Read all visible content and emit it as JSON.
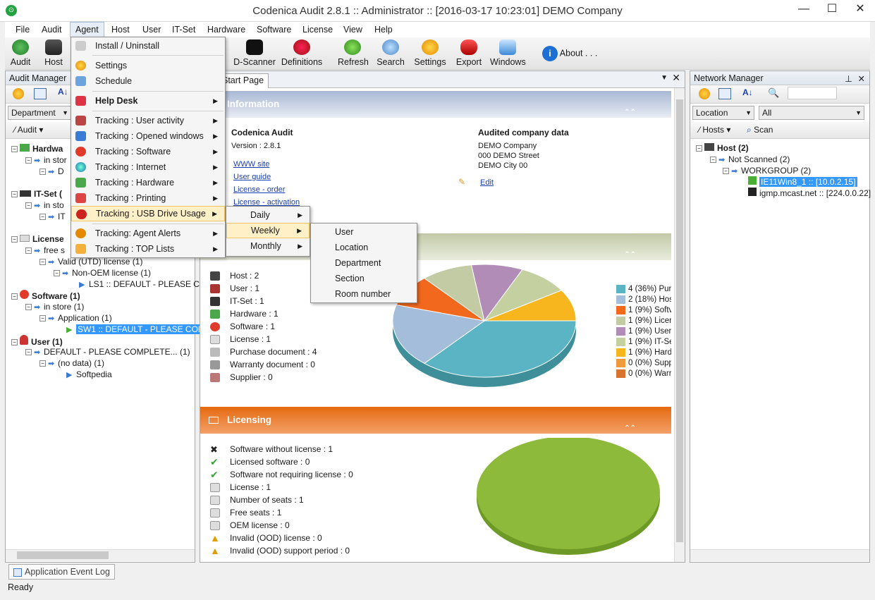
{
  "window": {
    "title": "Codenica Audit 2.8.1  ::  Administrator  ::  [2016-03-17 10:23:01] DEMO Company",
    "min": "—",
    "max": "☐",
    "close": "✕"
  },
  "menu": [
    "File",
    "Audit",
    "Agent",
    "Host",
    "User",
    "IT-Set",
    "Hardware",
    "Software",
    "License",
    "View",
    "Help"
  ],
  "toolbar": {
    "audit": "Audit",
    "host": "Host",
    "dscanner": "D-Scanner",
    "definitions": "Definitions",
    "refresh": "Refresh",
    "search": "Search",
    "settings": "Settings",
    "export": "Export",
    "windows": "Windows",
    "about": "About . . ."
  },
  "audit_manager": {
    "title": "Audit Manager",
    "combo": "Department",
    "audit_btn": "Audit",
    "tree": [
      "Hardwa",
      "in stor",
      "D",
      "IT-Set (",
      "in sto",
      "IT",
      "License",
      "free s",
      "Valid (UTD) license (1)",
      "Non-OEM license (1)",
      "LS1 :: DEFAULT - PLEASE COM",
      "Software (1)",
      "in store (1)",
      "Application (1)",
      "SW1 :: DEFAULT - PLEASE COMPL",
      "User (1)",
      "DEFAULT - PLEASE COMPLETE... (1)",
      "(no data) (1)",
      "Softpedia"
    ]
  },
  "agent_menu": [
    {
      "label": "Install / Uninstall",
      "sub": false
    },
    {
      "label": "Settings",
      "sub": false
    },
    {
      "label": "Schedule",
      "sub": false
    },
    {
      "label": "Help Desk",
      "sub": true,
      "bold": true
    },
    {
      "label": "Tracking : User activity",
      "sub": true
    },
    {
      "label": "Tracking : Opened windows",
      "sub": true
    },
    {
      "label": "Tracking : Software",
      "sub": true
    },
    {
      "label": "Tracking : Internet",
      "sub": true
    },
    {
      "label": "Tracking : Hardware",
      "sub": true
    },
    {
      "label": "Tracking : Printing",
      "sub": true
    },
    {
      "label": "Tracking : USB Drive Usage",
      "sub": true,
      "highlighted": true
    },
    {
      "label": "Tracking: Agent Alerts",
      "sub": true
    },
    {
      "label": "Tracking : TOP Lists",
      "sub": true
    }
  ],
  "usb_submenu": [
    "Daily",
    "Weekly",
    "Monthly"
  ],
  "weekly_submenu": [
    "User",
    "Location",
    "Department",
    "Section",
    "Room number"
  ],
  "start_page": {
    "tab": "Start Page",
    "info_header": "Information",
    "app_name": "Codenica Audit",
    "version": "Version : 2.8.1",
    "links": [
      "WWW site",
      "User guide",
      "License - order",
      "License - activation"
    ],
    "company_title": "Audited company data",
    "company": [
      "DEMO Company",
      "000 DEMO Street",
      "DEMO City 00"
    ],
    "edit": "Edit",
    "stats": [
      "Host : 2",
      "User : 1",
      "IT-Set : 1",
      "Hardware : 1",
      "Software : 1",
      "License : 1",
      "Purchase document : 4",
      "Warranty document : 0",
      "Supplier : 0"
    ],
    "licensing_header": "Licensing",
    "lic_stats": [
      "Software without license : 1",
      "Licensed software : 0",
      "Software not requiring license : 0",
      "License : 1",
      "Number of seats : 1",
      "Free seats : 1",
      "OEM license : 0",
      "Invalid (OOD) license : 0",
      "Invalid (OOD) support period : 0"
    ]
  },
  "chart_data": [
    {
      "type": "pie",
      "series": [
        {
          "values": [
            4,
            2,
            1,
            1,
            1,
            1,
            1,
            0,
            0
          ],
          "labels": [
            "4 (36%) Pur",
            "2 (18%) Hos",
            "1 (9%) Softv",
            "1 (9%) Licer",
            "1 (9%) User",
            "1 (9%) IT-Se",
            "1 (9%) Hard",
            "0 (0%) Supp",
            "0 (0%) Warr"
          ]
        }
      ],
      "colors": [
        "#5ab4c3",
        "#a3bddb",
        "#f2691e",
        "#c3cba4",
        "#b08cb7",
        "#c5d0a0",
        "#f7b51e",
        "#f09a3c",
        "#d9742e"
      ]
    },
    {
      "type": "pie",
      "series": [
        {
          "values": [
            1
          ],
          "labels": [
            ""
          ]
        }
      ],
      "colors": [
        "#8dba3a"
      ]
    }
  ],
  "network_manager": {
    "title": "Network Manager",
    "location_combo": "Location",
    "all_combo": "All",
    "hosts_btn": "Hosts",
    "scan_btn": "Scan",
    "tree": [
      "Host (2)",
      "Not Scanned (2)",
      "WORKGROUP (2)",
      "IE11Win8_1 :: [10.0.2.15]",
      "igmp.mcast.net :: [224.0.0.22]"
    ]
  },
  "bottom_tab": "Application Event Log",
  "status": "Ready"
}
